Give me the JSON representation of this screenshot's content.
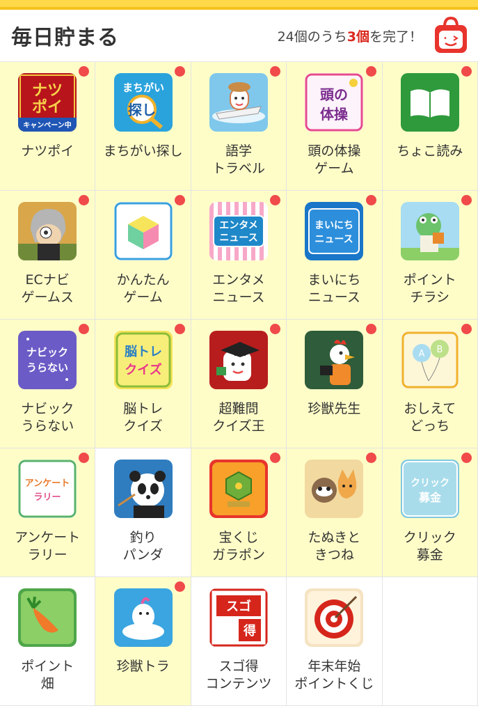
{
  "header": {
    "title": "毎日貯まる",
    "progress_prefix": "24個のうち",
    "progress_done": "3個",
    "progress_suffix": "を完了！"
  },
  "apps": [
    {
      "id": "natsupoi",
      "label": "ナツポイ",
      "bg": "yellow",
      "dot": true,
      "icon_text": "ナツ\nポイ",
      "icon_sub": "キャンペーン中"
    },
    {
      "id": "machigai",
      "label": "まちがい探し",
      "bg": "yellow",
      "dot": true,
      "icon_text": "まちがい\n探し"
    },
    {
      "id": "gogaku",
      "label": "語学\nトラベル",
      "bg": "yellow",
      "dot": true
    },
    {
      "id": "atama",
      "label": "頭の体操\nゲーム",
      "bg": "yellow",
      "dot": true,
      "icon_text": "頭の\n体操"
    },
    {
      "id": "chokoyomi",
      "label": "ちょこ読み",
      "bg": "yellow",
      "dot": true
    },
    {
      "id": "ecnavi",
      "label": "ECナビ\nゲームス",
      "bg": "yellow",
      "dot": true
    },
    {
      "id": "kantan",
      "label": "かんたん\nゲーム",
      "bg": "yellow",
      "dot": true
    },
    {
      "id": "entame",
      "label": "エンタメ\nニュース",
      "bg": "yellow",
      "dot": true,
      "icon_text": "エンタメ\nニュース"
    },
    {
      "id": "mainichi",
      "label": "まいにち\nニュース",
      "bg": "yellow",
      "dot": true,
      "icon_text": "まいにち\nニュース"
    },
    {
      "id": "chirashi",
      "label": "ポイント\nチラシ",
      "bg": "yellow",
      "dot": true
    },
    {
      "id": "uranai",
      "label": "ナビック\nうらない",
      "bg": "yellow",
      "dot": true,
      "icon_text": "ナビック\nうらない"
    },
    {
      "id": "noutore",
      "label": "脳トレ\nクイズ",
      "bg": "yellow",
      "dot": true,
      "icon_text": "脳トレ\nクイズ"
    },
    {
      "id": "quizking",
      "label": "超難問\nクイズ王",
      "bg": "yellow",
      "dot": true
    },
    {
      "id": "chinju",
      "label": "珍獣先生",
      "bg": "yellow",
      "dot": true
    },
    {
      "id": "oshiete",
      "label": "おしえて\nどっち",
      "bg": "yellow",
      "dot": true,
      "icon_text": "A B"
    },
    {
      "id": "enquete",
      "label": "アンケート\nラリー",
      "bg": "yellow",
      "dot": true,
      "icon_text": "アンケート\nラリー"
    },
    {
      "id": "panda",
      "label": "釣り\nパンダ",
      "bg": "white",
      "dot": false
    },
    {
      "id": "takarakuji",
      "label": "宝くじ\nガラポン",
      "bg": "yellow",
      "dot": true
    },
    {
      "id": "tanuki",
      "label": "たぬきと\nきつね",
      "bg": "yellow",
      "dot": true
    },
    {
      "id": "click",
      "label": "クリック\n募金",
      "bg": "yellow",
      "dot": true,
      "icon_text": "クリック\n募金"
    },
    {
      "id": "hatake",
      "label": "ポイント\n畑",
      "bg": "white",
      "dot": false
    },
    {
      "id": "chinjutora",
      "label": "珍獣トラ",
      "bg": "yellow",
      "dot": true
    },
    {
      "id": "sugotoku",
      "label": "スゴ得\nコンテンツ",
      "bg": "white",
      "dot": false,
      "icon_text": "スゴ\n得"
    },
    {
      "id": "nenmatsu",
      "label": "年末年始\nポイントくじ",
      "bg": "white",
      "dot": false
    },
    {
      "id": "empty",
      "label": "",
      "bg": "white",
      "dot": false
    }
  ]
}
